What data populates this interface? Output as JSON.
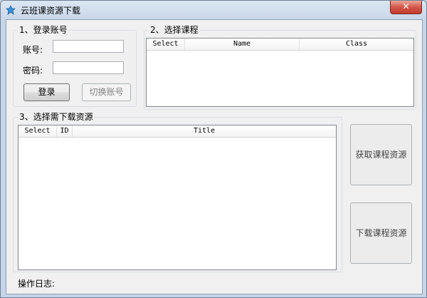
{
  "window": {
    "title": "云班课资源下载",
    "close_label": "✕"
  },
  "login": {
    "group_label": "1、登录账号",
    "account_label": "账号:",
    "account_value": "",
    "password_label": "密码:",
    "password_value": "",
    "login_button": "登录",
    "switch_button": "切换账号"
  },
  "courses": {
    "group_label": "2、选择课程",
    "columns": [
      "Select",
      "Name",
      "Class"
    ]
  },
  "resources": {
    "group_label": "3、选择需下载资源",
    "columns": [
      "Select",
      "ID",
      "Title"
    ]
  },
  "actions": {
    "fetch_button": "获取课程资源",
    "download_button": "下载课程资源"
  },
  "log": {
    "label": "操作日志:"
  }
}
